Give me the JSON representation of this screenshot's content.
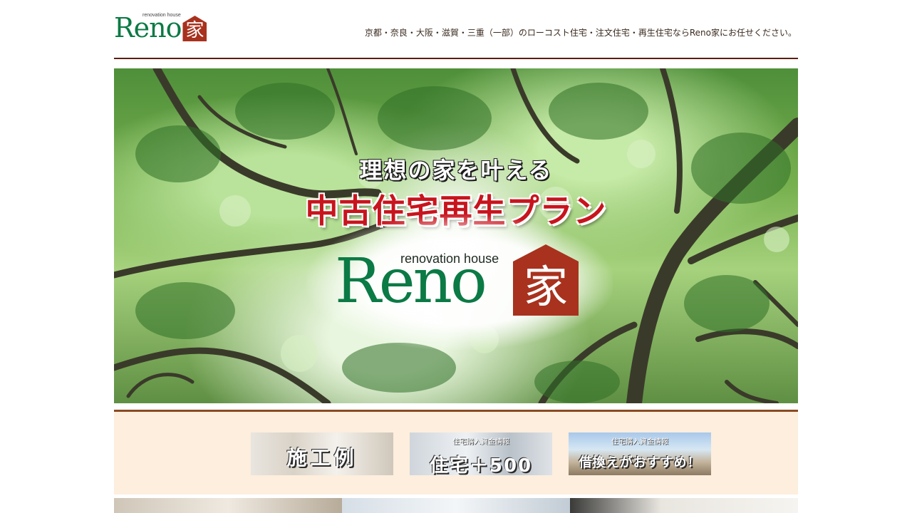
{
  "header": {
    "logo": {
      "word": "Reno",
      "tagline": "renovation house",
      "kanji": "家"
    },
    "tagline": "京都・奈良・大阪・滋賀・三重（一部）のローコスト住宅・注文住宅・再生住宅ならReno家にお任せください。"
  },
  "hero": {
    "line1": "理想の家を叶える",
    "line2": "中古住宅再生プラン",
    "logo": {
      "tagline": "renovation house",
      "word": "Reno",
      "kanji": "家"
    }
  },
  "banners": [
    {
      "small": "",
      "big": "施工例",
      "icon": "construction-examples-banner"
    },
    {
      "small": "住宅購入資金情報",
      "big": "住宅＋500",
      "icon": "housing-funds-banner"
    },
    {
      "small": "住宅購入資金情報",
      "big": "借換えがおすすめ！",
      "icon": "refinance-banner"
    }
  ],
  "colors": {
    "brand_green": "#0b7a45",
    "brand_red": "#a8321e",
    "header_rule": "#5a1e0f",
    "banner_bg": "#fdeedd",
    "headline_red": "#c8141d"
  }
}
